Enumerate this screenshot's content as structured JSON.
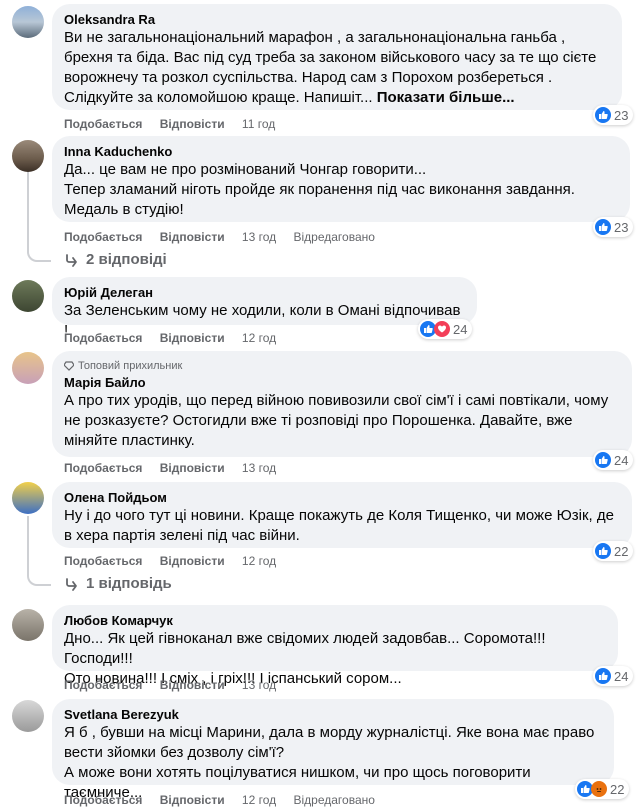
{
  "actions": {
    "like": "Подобається",
    "reply": "Відповісти",
    "edited": "Відредаговано"
  },
  "comments": [
    {
      "author": "Oleksandra Ra",
      "text": "Ви не загальнонаціональний марафон , а загальнонаціональна ганьба , брехня та біда. Вас під суд треба за законом військового часу за те що сієте ворожнечу та розкол суспільства. Народ сам з Порохом розбереться . Слідкуйте за коломойшою краще. Напишіт...",
      "more": "Показати більше...",
      "time": "11 год",
      "reactions": "23"
    },
    {
      "author": "Inna Kaduchenko",
      "text": "Да... це вам не про розмінований Чонгар говорити...\nТепер зламаний ніготь пройде як поранення під час виконання завдання.\nМедаль в студію!",
      "time": "13 год",
      "edited": true,
      "reactions": "23",
      "replies": "2 відповіді"
    },
    {
      "author": "Юрій Делеган",
      "text": "За Зеленським чому не ходили, коли в Омані відпочивав !",
      "time": "12 год",
      "reactions": "24"
    },
    {
      "badge": "Топовий прихильник",
      "author": "Марія Байло",
      "text": "А про тих уродів, що перед війною повивозили свої сім'ї і самі повтікали, чому не розказуєте? Остогидли вже ті розповіді про Порошенка. Давайте, вже міняйте пластинку.",
      "time": "13 год",
      "reactions": "24"
    },
    {
      "author": "Олена Пойдьом",
      "text": "Ну і до чого тут ці новини. Краще покажуть де Коля Тищенко, чи може Юзік, де в хера партія зелені під час війни.",
      "time": "12 год",
      "reactions": "22",
      "replies": "1 відповідь"
    },
    {
      "author": "Любов Комарчук",
      "text": "Дно... Як цей гівноканал вже свідомих людей задовбав... Соромота!!! Господи!!!\nОто новина!!! І сміх , і гріх!!! І іспанський сором...",
      "time": "13 год",
      "reactions": "24"
    },
    {
      "author": "Svetlana Berezyuk",
      "text": "Я б , бувши на місці Марини, дала в морду журналістці. Яке вона має право вести зйомки без дозволу сім'ї?\nА може вони хотять поцілуватися нишком, чи про щось поговорити таємниче...",
      "time": "12 год",
      "edited": true,
      "reactions": "22"
    }
  ],
  "colors": {
    "bubble": "#f0f2f5",
    "like": "#1877f2",
    "love": "#f33e58",
    "angry": "#e9710f",
    "meta": "#65676b"
  },
  "icons": [
    "like-icon",
    "love-icon",
    "angry-icon",
    "reply-arrow-icon",
    "diamond-icon"
  ]
}
